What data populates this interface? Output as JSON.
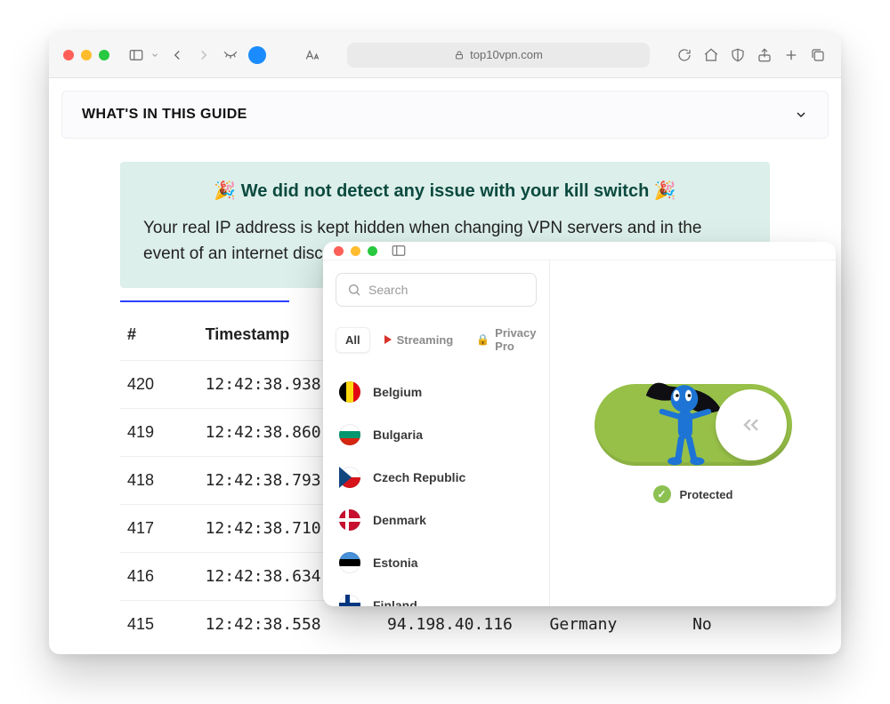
{
  "browser": {
    "url_host": "top10vpn.com"
  },
  "guide": {
    "title": "WHAT'S IN THIS GUIDE"
  },
  "notice": {
    "headline": "🎉 We did not detect any issue with your kill switch 🎉",
    "body": "Your real IP address is kept hidden when changing VPN servers and in the event of an internet disconnection."
  },
  "table": {
    "headers": [
      "#",
      "Timestamp",
      "",
      "",
      ""
    ],
    "rows": [
      {
        "n": "420",
        "ts": "12:42:38.938",
        "ip": "",
        "country": "",
        "leak": ""
      },
      {
        "n": "419",
        "ts": "12:42:38.860",
        "ip": "",
        "country": "",
        "leak": ""
      },
      {
        "n": "418",
        "ts": "12:42:38.793",
        "ip": "",
        "country": "",
        "leak": ""
      },
      {
        "n": "417",
        "ts": "12:42:38.710",
        "ip": "",
        "country": "",
        "leak": ""
      },
      {
        "n": "416",
        "ts": "12:42:38.634",
        "ip": "",
        "country": "",
        "leak": ""
      },
      {
        "n": "415",
        "ts": "12:42:38.558",
        "ip": "94.198.40.116",
        "country": "Germany",
        "leak": "No"
      }
    ]
  },
  "vpn": {
    "search_placeholder": "Search",
    "tabs": {
      "all": "All",
      "streaming": "Streaming",
      "privacy": "Privacy Pro"
    },
    "countries": [
      {
        "name": "Belgium",
        "flag": "flag-be"
      },
      {
        "name": "Bulgaria",
        "flag": "flag-bg"
      },
      {
        "name": "Czech Republic",
        "flag": "flag-cz"
      },
      {
        "name": "Denmark",
        "flag": "flag-dk"
      },
      {
        "name": "Estonia",
        "flag": "flag-ee"
      },
      {
        "name": "Finland",
        "flag": "flag-fi"
      }
    ],
    "status": "Protected"
  }
}
